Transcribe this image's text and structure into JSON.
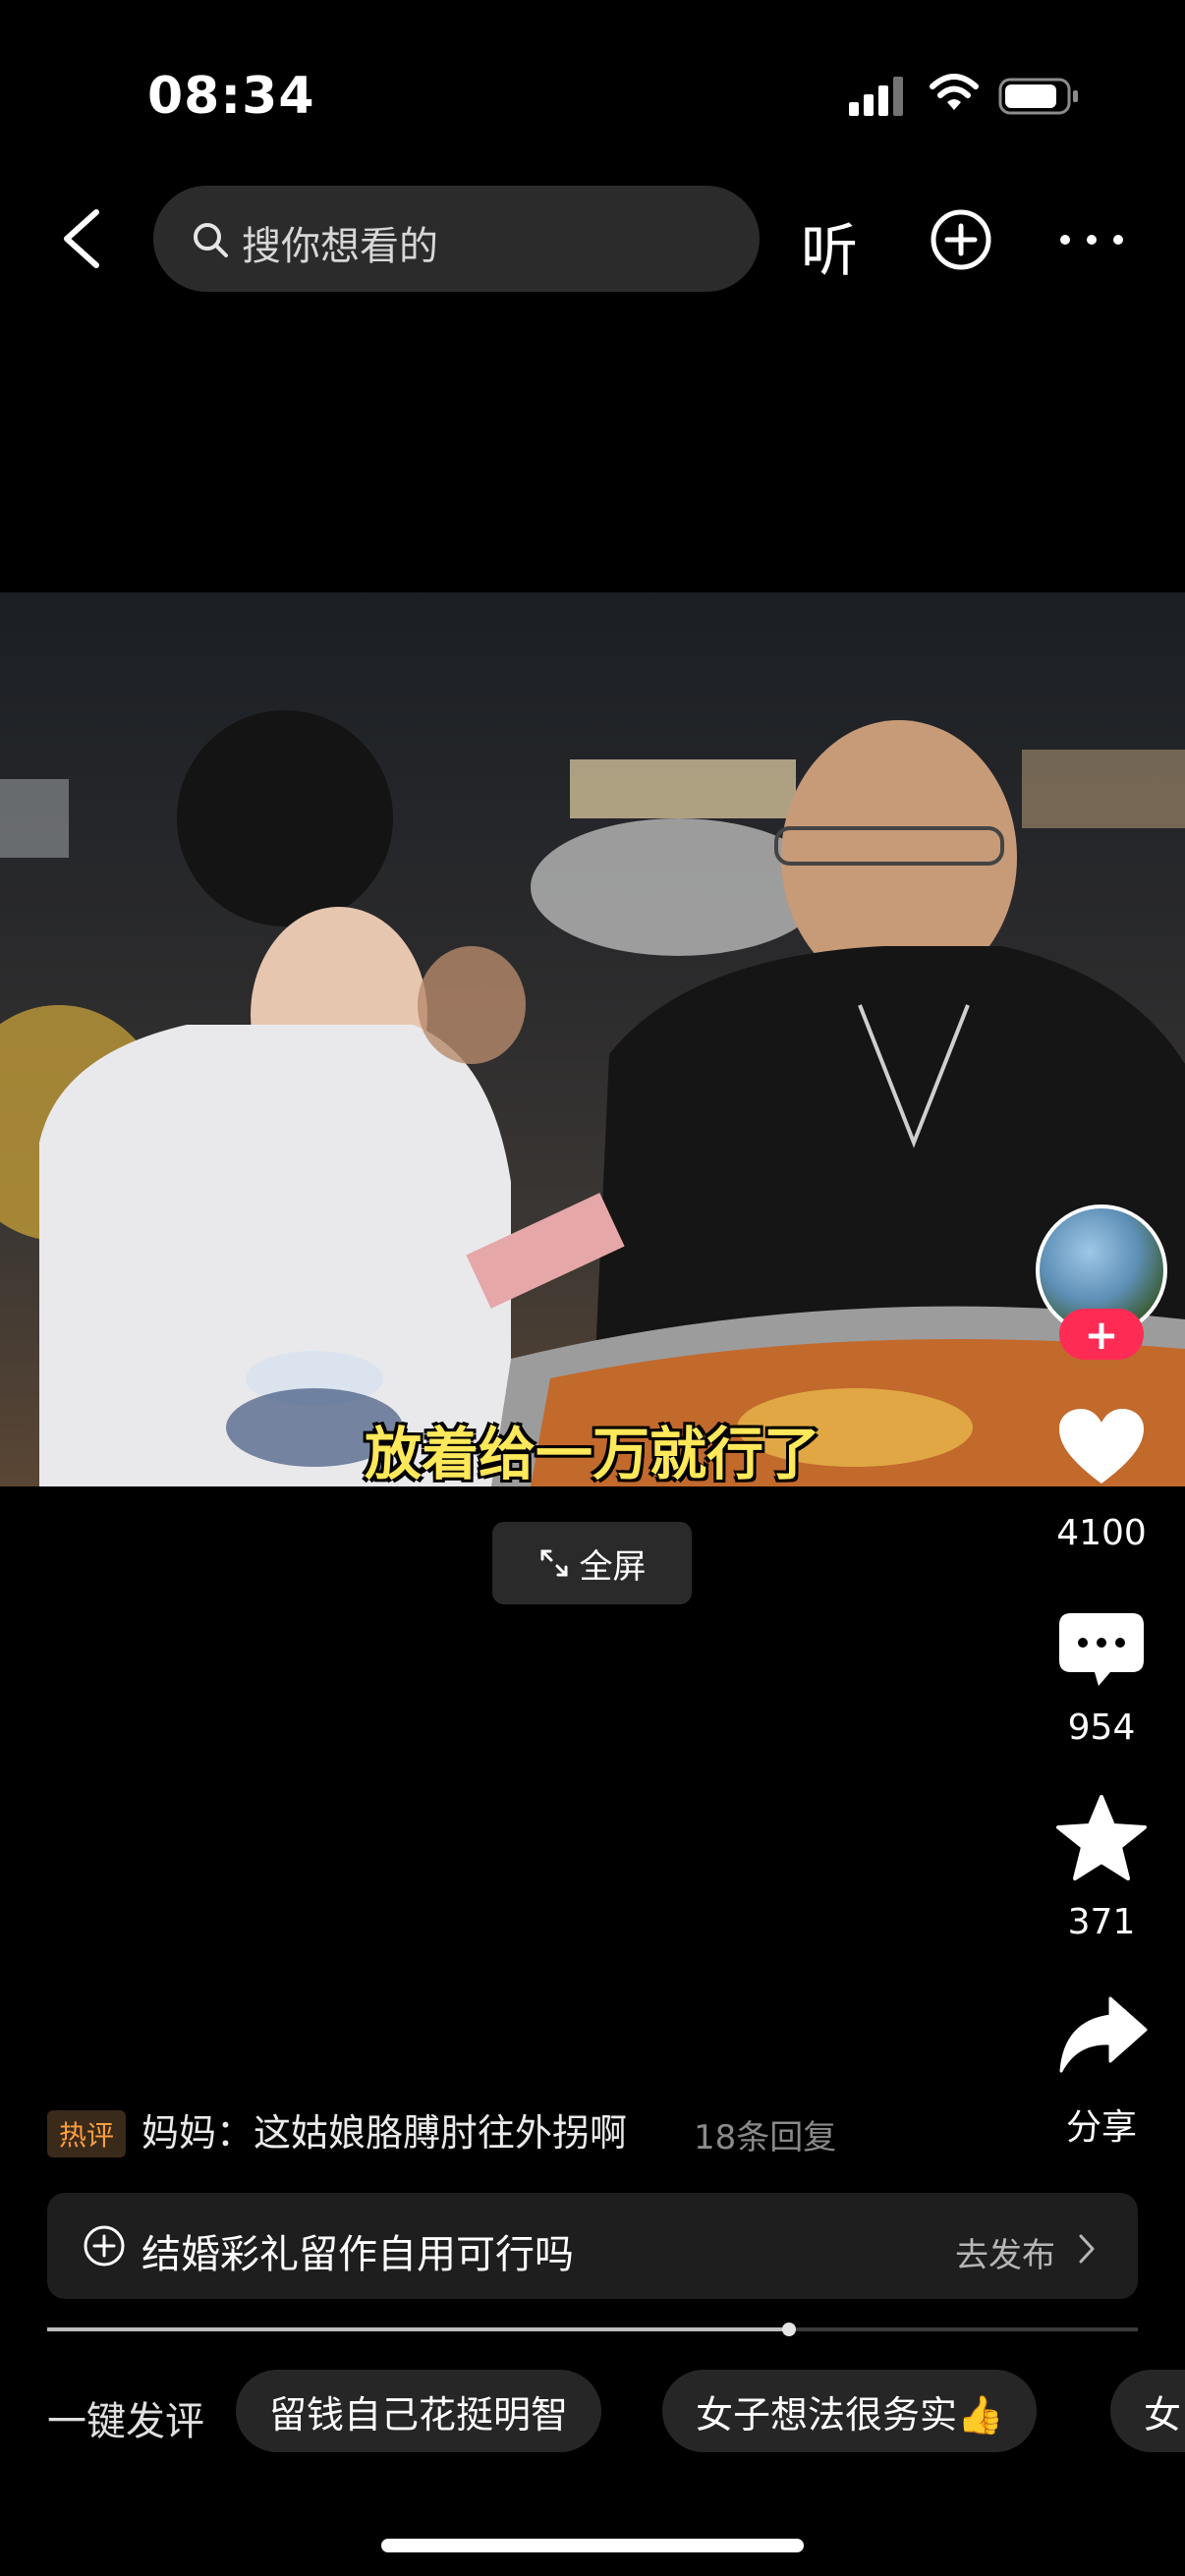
{
  "status_bar": {
    "time": "08:34"
  },
  "nav": {
    "search_placeholder": "搜你想看的",
    "listen_label": "听"
  },
  "video": {
    "subtitle": "放着给一万就行了",
    "fullscreen_label": "全屏"
  },
  "actions": {
    "likes": "4100",
    "comments": "954",
    "favorites": "371",
    "share_label": "分享"
  },
  "hot_comment": {
    "tag": "热评",
    "text": "妈妈：这姑娘胳膊肘往外拐啊",
    "replies": "18条回复"
  },
  "topic": {
    "text": "结婚彩礼留作自用可行吗",
    "action": "去发布"
  },
  "progress": {
    "fraction": 0.68
  },
  "quick_comments": {
    "label": "一键发评",
    "chips": [
      "留钱自己花挺明智",
      "女子想法很务实👍",
      "女"
    ]
  },
  "colors": {
    "follow": "#fe2c55",
    "subtitle": "#ffe85a",
    "hot_tag": "#ff9e3d"
  },
  "icons": [
    "back-icon",
    "search-icon",
    "add-icon",
    "more-icon",
    "fullscreen-icon",
    "heart-icon",
    "comment-icon",
    "star-icon",
    "share-icon",
    "plus-circle-icon",
    "chevron-right-icon"
  ]
}
